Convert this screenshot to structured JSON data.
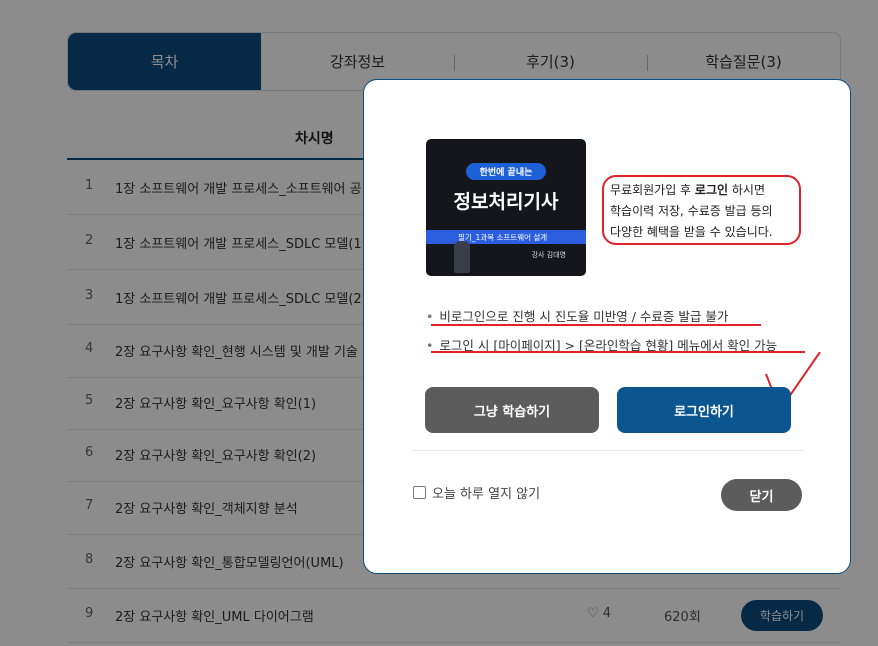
{
  "tabs": [
    {
      "label": "목차"
    },
    {
      "label": "강좌정보"
    },
    {
      "label": "후기(3)"
    },
    {
      "label": "학습질문(3)"
    }
  ],
  "table": {
    "header_title": "차시명",
    "rows": [
      {
        "num": "1",
        "title": "1장 소프트웨어 개발 프로세스_소프트웨어 공"
      },
      {
        "num": "2",
        "title": "1장 소프트웨어 개발 프로세스_SDLC 모델(1"
      },
      {
        "num": "3",
        "title": "1장 소프트웨어 개발 프로세스_SDLC 모델(2"
      },
      {
        "num": "4",
        "title": "2장 요구사항 확인_현행 시스템 및 개발 기술"
      },
      {
        "num": "5",
        "title": "2장 요구사항 확인_요구사항 확인(1)"
      },
      {
        "num": "6",
        "title": "2장 요구사항 확인_요구사항 확인(2)"
      },
      {
        "num": "7",
        "title": "2장 요구사항 확인_객체지향 분석"
      },
      {
        "num": "8",
        "title": "2장 요구사항 확인_통합모델링언어(UML)"
      },
      {
        "num": "9",
        "title": "2장 요구사항 확인_UML 다이어그램",
        "likes": "4",
        "views": "620회",
        "study_label": "학습하기"
      }
    ]
  },
  "modal": {
    "thumbnail": {
      "pill": "한번에 끝내는",
      "title": "정보처리기사",
      "band": "필기_1과목 소프트웨어 설계",
      "teacher": "강사 김대영"
    },
    "note_line1_a": "무료회원가입 후 ",
    "note_line1_b": "로그인",
    "note_line1_c": " 하시면",
    "note_line2": "학습이력 저장, 수료증 발급 등의",
    "note_line3": "다양한 혜택을 받을 수 있습니다.",
    "bullet1": "비로그인으로 진행 시 진도율 미반영 / 수료증 발급 불가",
    "bullet2": "로그인 시 [마이페이지] > [온라인학습 현황] 메뉴에서 확인 가능",
    "btn_plain": "그냥 학습하기",
    "btn_login": "로그인하기",
    "no_show_today": "오늘 하루 열지 않기",
    "close": "닫기"
  },
  "colors": {
    "navy": "#0b4d7e",
    "annotation_red": "#e0222a"
  }
}
